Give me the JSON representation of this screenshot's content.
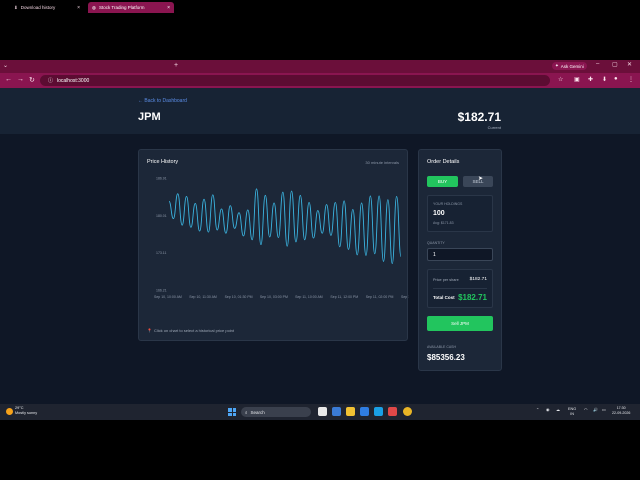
{
  "browser": {
    "tabs": [
      {
        "label": "Download history",
        "active": false
      },
      {
        "label": "Stock Trading Platform",
        "active": true
      }
    ],
    "url": "localhost:3000",
    "gemini_label": "Ask Gemini"
  },
  "header": {
    "back_link": "← Back to Dashboard",
    "symbol": "JPM",
    "price": "$182.71",
    "price_caption": "Current"
  },
  "price_history": {
    "title": "Price History",
    "interval": "30 minute intervals",
    "hint": "Click on chart to select a historical price point"
  },
  "chart_data": {
    "type": "line",
    "title": "Price History",
    "color": "#3bb4e0",
    "y_tick_labels": [
      "186.91",
      "180.01",
      "173.11",
      "166.21"
    ],
    "ylim": [
      166.21,
      186.91
    ],
    "x_tick_labels": [
      "Sep 10, 10:00 AM",
      "Sep 10, 11:30 AM",
      "Sep 10, 01:30 PM",
      "Sep 10, 03:00 PM",
      "Sep 11, 10:00 AM",
      "Sep 11, 12:00 PM",
      "Sep 11, 02:00 PM",
      "Sep 11, 0"
    ],
    "grid": false,
    "series": [
      {
        "values": [
          182.6,
          179.4,
          184.0,
          178.2,
          183.5,
          177.8,
          182.2,
          177.1,
          183.0,
          176.9,
          183.8,
          177.3,
          181.2,
          176.7,
          181.8,
          177.6,
          180.5,
          176.2,
          181.0,
          175.5,
          184.9,
          174.6,
          183.7,
          176.0,
          182.3,
          175.9,
          184.3,
          174.3,
          184.5,
          175.1,
          183.7,
          175.5,
          182.4,
          175.8,
          180.9,
          176.7,
          182.0,
          176.3,
          182.4,
          174.2,
          182.7,
          173.7,
          181.1,
          172.7,
          182.3,
          172.6,
          183.6,
          172.9,
          183.6,
          171.5,
          182.9,
          171.1,
          183.5,
          172.4
        ]
      }
    ]
  },
  "order": {
    "title": "Order Details",
    "buy_label": "BUY",
    "sell_label": "SELL",
    "holdings_label": "YOUR HOLDINGS",
    "holdings_value": "100",
    "holdings_avg": "Avg: $171.83",
    "quantity_label": "QUANTITY",
    "quantity_value": "1",
    "price_per_share_label": "Price per share",
    "price_per_share_value": "$182.71",
    "total_cost_label": "Total Cost",
    "total_cost_value": "$182.71",
    "submit_label": "Sell JPM",
    "cash_label": "AVAILABLE CASH",
    "cash_value": "$85356.23"
  },
  "taskbar": {
    "temperature": "29°C",
    "weather": "Mostly sunny",
    "search_label": "Search",
    "lang_top": "ENG",
    "lang_bottom": "IN",
    "time": "17:30",
    "date": "22-09-2026"
  }
}
